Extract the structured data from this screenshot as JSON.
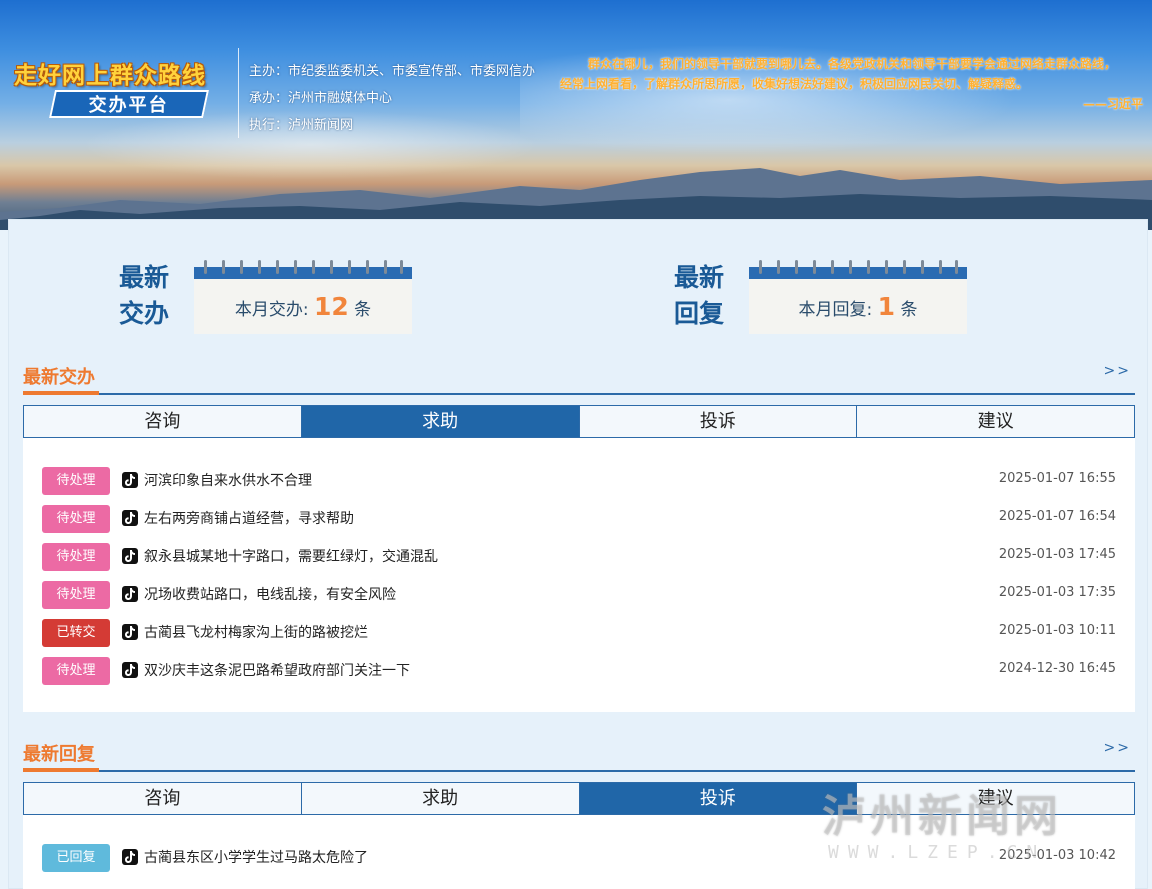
{
  "header": {
    "logo_title": "走好网上群众路线",
    "logo_subtitle": "交办平台",
    "org": [
      "主办：市纪委监委机关、市委宣传部、市委网信办",
      "承办：泸州市融媒体中心",
      "执行：泸州新闻网"
    ],
    "quote": [
      "群众在哪儿，我们的领导干部就要到哪儿去。各级党政机关和领导干部要学会通过网络走群众路线，",
      "经常上网看看，了解群众所思所愿，收集好想法好建议，积极回应网民关切、解疑释惑。"
    ],
    "quote_author": "——习近平"
  },
  "stats": {
    "assigned": {
      "label_line1": "最新",
      "label_line2": "交办",
      "text": "本月交办:",
      "count": "12",
      "unit": "条"
    },
    "replied": {
      "label_line1": "最新",
      "label_line2": "回复",
      "text": "本月回复:",
      "count": "1",
      "unit": "条"
    }
  },
  "latest_assigned": {
    "title": "最新交办",
    "more": ">>",
    "tabs": [
      "咨询",
      "求助",
      "投诉",
      "建议"
    ],
    "active_tab": "求助",
    "items": [
      {
        "status": "待处理",
        "title": "河滨印象自来水供水不合理",
        "date": "2025-01-07 16:55"
      },
      {
        "status": "待处理",
        "title": "左右两旁商铺占道经营，寻求帮助",
        "date": "2025-01-07 16:54"
      },
      {
        "status": "待处理",
        "title": "叙永县城某地十字路口，需要红绿灯，交通混乱",
        "date": "2025-01-03 17:45"
      },
      {
        "status": "待处理",
        "title": "况场收费站路口，电线乱接，有安全风险",
        "date": "2025-01-03 17:35"
      },
      {
        "status": "已转交",
        "title": "古蔺县飞龙村梅家沟上街的路被挖烂",
        "date": "2025-01-03 10:11"
      },
      {
        "status": "待处理",
        "title": "双沙庆丰这条泥巴路希望政府部门关注一下",
        "date": "2024-12-30 16:45"
      }
    ]
  },
  "latest_replies": {
    "title": "最新回复",
    "more": ">>",
    "tabs": [
      "咨询",
      "求助",
      "投诉",
      "建议"
    ],
    "active_tab": "投诉",
    "items": [
      {
        "status": "已回复",
        "title": "古蔺县东区小学学生过马路太危险了",
        "date": "2025-01-03 10:42"
      }
    ]
  },
  "watermark": {
    "line1": "泸州新闻网",
    "line2": "WWW.LZEP.CN"
  },
  "colors": {
    "pending": "#ec6aa4",
    "forwarded": "#d43b35",
    "replied": "#5fbadc",
    "accent_orange": "#ee7a30",
    "brand_blue": "#2066a8"
  }
}
